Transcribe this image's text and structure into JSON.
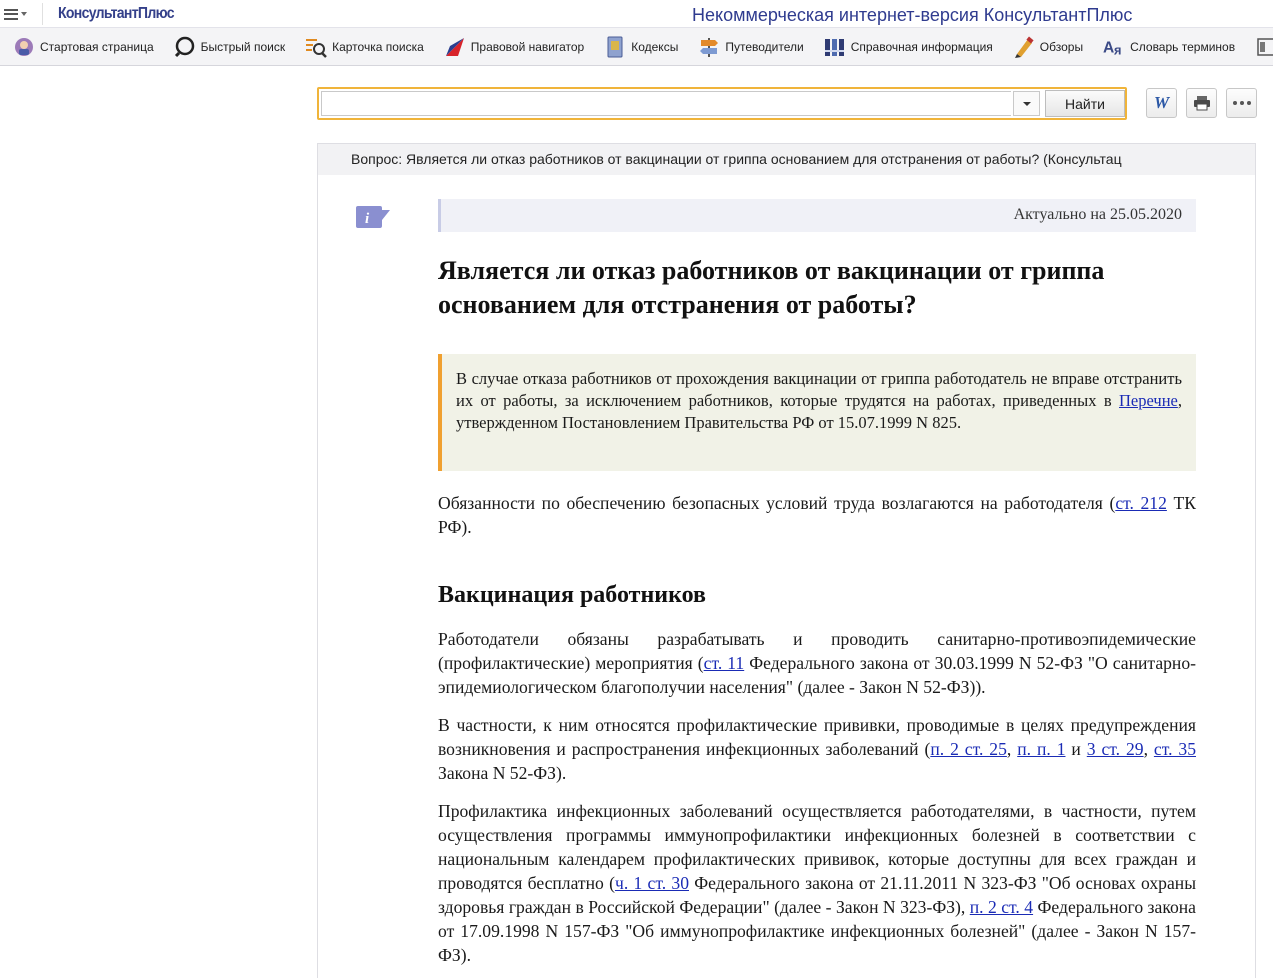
{
  "header": {
    "logo": "КонсультантПлюс",
    "title": "Некоммерческая интернет-версия КонсультантПлюс"
  },
  "toolbar": {
    "items": [
      {
        "label": "Стартовая страница",
        "icon": "home-icon"
      },
      {
        "label": "Быстрый поиск",
        "icon": "magnifier-icon"
      },
      {
        "label": "Карточка поиска",
        "icon": "search-card-icon"
      },
      {
        "label": "Правовой навигатор",
        "icon": "navigator-icon"
      },
      {
        "label": "Кодексы",
        "icon": "codex-icon"
      },
      {
        "label": "Путеводители",
        "icon": "signpost-icon"
      },
      {
        "label": "Справочная информация",
        "icon": "books-icon"
      },
      {
        "label": "Обзоры",
        "icon": "pen-icon"
      },
      {
        "label": "Словарь терминов",
        "icon": "dictionary-icon"
      }
    ]
  },
  "search": {
    "value": "",
    "button": "Найти"
  },
  "document": {
    "tab_title": "Вопрос: Является ли отказ работников от вакцинации от гриппа основанием для отстранения от работы? (Консультац",
    "actual": "Актуально на 25.05.2020",
    "title": "Является ли отказ работников от вакцинации от гриппа основанием для отстранения от работы?",
    "note": {
      "before_link": "В случае отказа работников от прохождения вакцинации от гриппа работодатель не вправе отстранить их от работы, за исключением работников, которые трудятся на работах, приведенных в ",
      "link": "Перечне",
      "after_link": ", утвержденном Постановлением Правительства РФ от 15.07.1999 N 825."
    },
    "p1": {
      "t1": "Обязанности по обеспечению безопасных условий труда возлагаются на работодателя (",
      "l1": "ст. 212",
      "t2": " ТК РФ)."
    },
    "section_heading": "Вакцинация работников",
    "p2": {
      "t1": "Работодатели обязаны разрабатывать и проводить санитарно-противоэпидемические (профилактические) мероприятия (",
      "l1": "ст. 11",
      "t2": " Федерального закона от 30.03.1999 N 52-ФЗ \"О санитарно-эпидемиологическом благополучии населения\" (далее - Закон N 52-ФЗ))."
    },
    "p3": {
      "t1": "В частности, к ним относятся профилактические прививки, проводимые в целях предупреждения возникновения и распространения инфекционных заболеваний (",
      "l1": "п. 2 ст. 25",
      "t2": ", ",
      "l2": "п. п. 1",
      "t3": " и ",
      "l3": "3 ст. 29",
      "t4": ", ",
      "l4": "ст. 35",
      "t5": " Закона N 52-ФЗ)."
    },
    "p4": {
      "t1": "Профилактика инфекционных заболеваний осуществляется работодателями, в частности, путем осуществления программы иммунопрофилактики инфекционных болезней в соответствии с национальным календарем профилактических прививок, которые доступны для всех граждан и проводятся бесплатно (",
      "l1": "ч. 1 ст. 30",
      "t2": " Федерального закона от 21.11.2011 N 323-ФЗ \"Об основах охраны здоровья граждан в Российской Федерации\" (далее - Закон N 323-ФЗ), ",
      "l2": "п. 2 ст. 4",
      "t3": " Федерального закона от 17.09.1998 N 157-ФЗ \"Об иммунопрофилактике инфекционных болезней\" (далее - Закон N 157-ФЗ)."
    }
  },
  "colors": {
    "brand": "#34408a",
    "note_accent": "#f0a030",
    "link": "#1a2bb5",
    "search_border": "#f0b43a"
  }
}
